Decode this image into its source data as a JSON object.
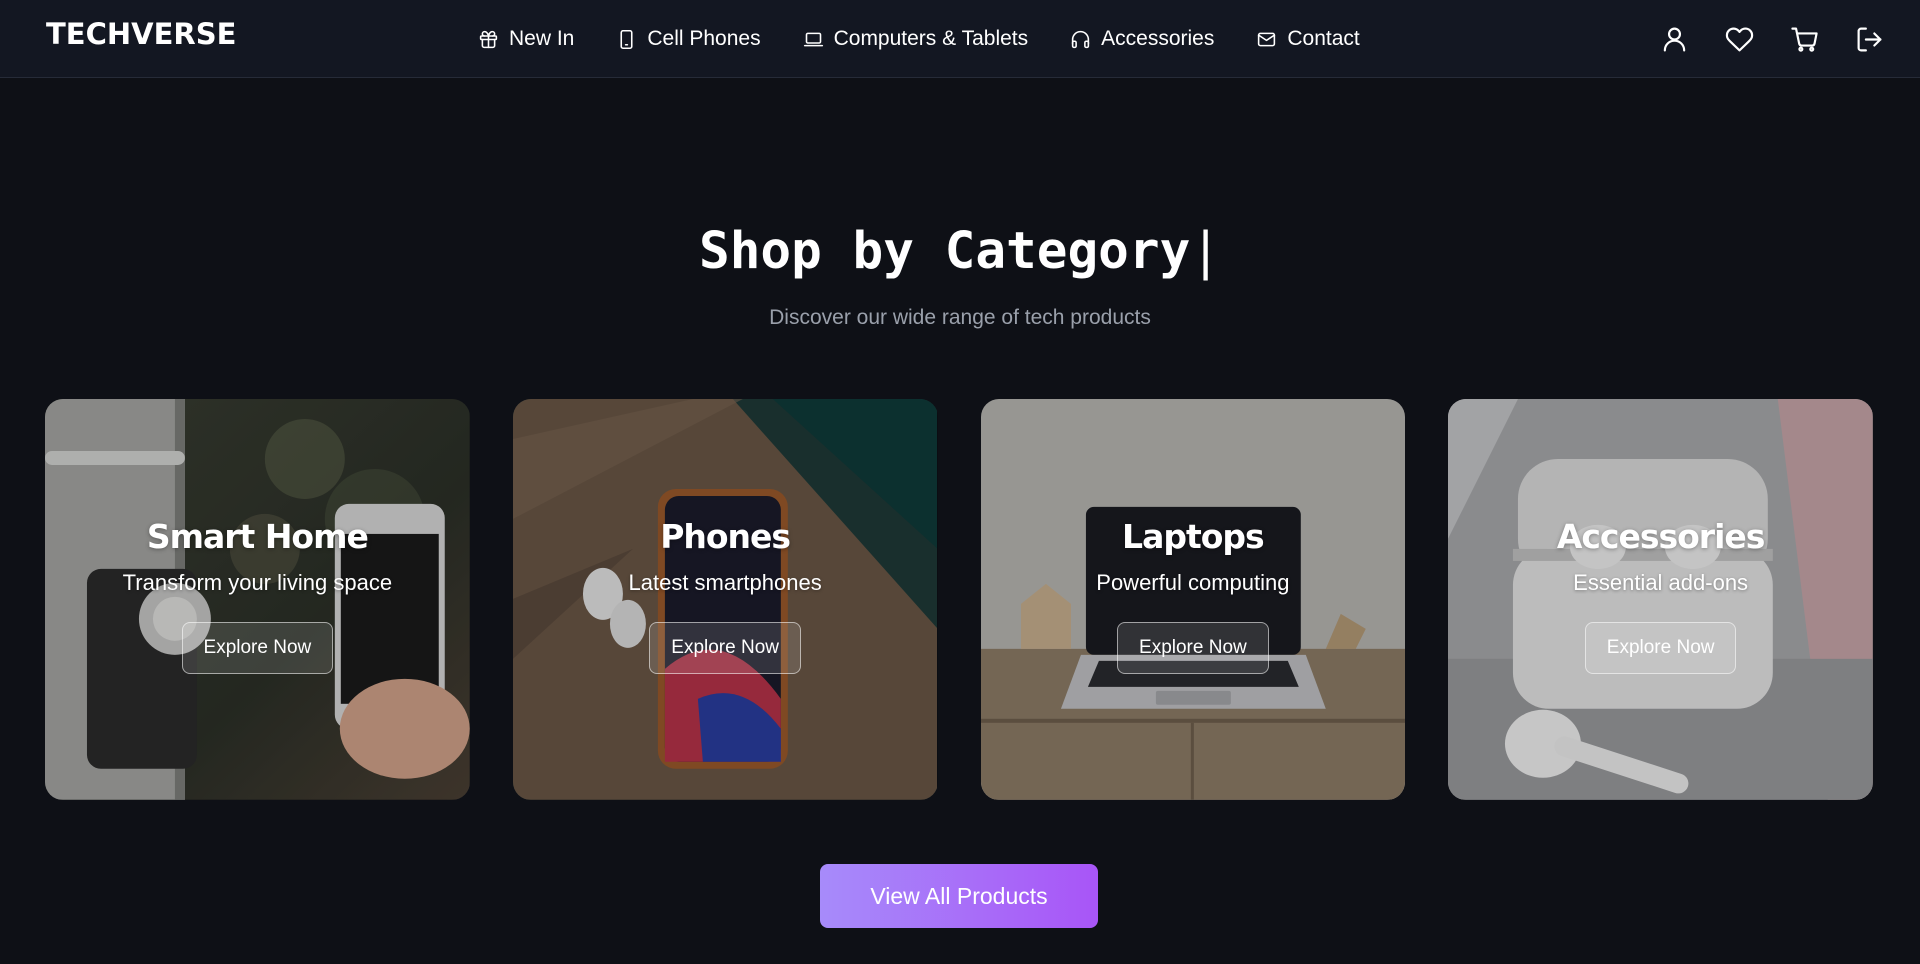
{
  "header": {
    "logo": "TECHVERSE",
    "nav": [
      {
        "label": "New In",
        "icon": "gift-icon"
      },
      {
        "label": "Cell Phones",
        "icon": "phone-icon"
      },
      {
        "label": "Computers & Tablets",
        "icon": "laptop-icon"
      },
      {
        "label": "Accessories",
        "icon": "headphones-icon"
      },
      {
        "label": "Contact",
        "icon": "mail-icon"
      }
    ],
    "actions": [
      "user-icon",
      "heart-icon",
      "cart-icon",
      "logout-icon"
    ]
  },
  "section": {
    "title": "Shop by Category",
    "caret": "|",
    "subtitle": "Discover our wide range of tech products"
  },
  "categories": [
    {
      "title": "Smart Home",
      "description": "Transform your living space",
      "button": "Explore Now"
    },
    {
      "title": "Phones",
      "description": "Latest smartphones",
      "button": "Explore Now"
    },
    {
      "title": "Laptops",
      "description": "Powerful computing",
      "button": "Explore Now"
    },
    {
      "title": "Accessories",
      "description": "Essential add-ons",
      "button": "Explore Now"
    }
  ],
  "view_all": {
    "label": "View All Products"
  },
  "colors": {
    "background": "#0e1016",
    "header": "#131722",
    "subtitle": "#9aa0ab",
    "accent_start": "#a78bfa",
    "accent_end": "#a855f7"
  }
}
